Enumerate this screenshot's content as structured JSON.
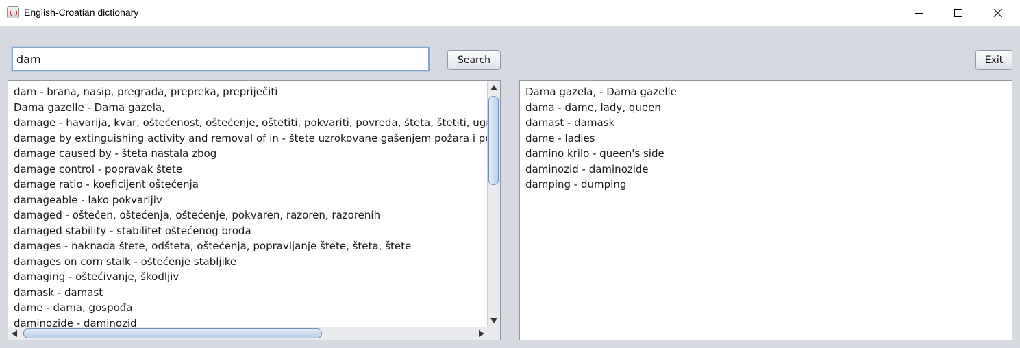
{
  "window": {
    "title": "English-Croatian dictionary"
  },
  "search": {
    "value": "dam",
    "button_label": "Search"
  },
  "exit_label": "Exit",
  "results_left": [
    "dam - brana, nasip, pregrada, prepreka, prepriječiti",
    "Dama gazelle - Dama gazela,",
    "damage - havarija, kvar, oštećenost, oštećenje, oštetiti, pokvariti, povreda, šteta, štetiti, ugruvat",
    "damage by extinguishing activity and removal of in - štete uzrokovane gašenjem požara i pomic",
    "damage caused by - šteta nastala zbog",
    "damage control - popravak štete",
    "damage ratio - koeficijent oštećenja",
    "damageable - lako pokvarljiv",
    "damaged - oštećen, oštećenja, oštećenje, pokvaren, razoren, razorenih",
    "damaged stability - stabilitet oštećenog broda",
    "damages - naknada štete, odšteta, oštećenja, popravljanje štete, šteta, štete",
    "damages on corn stalk - oštećenje stabljike",
    "damaging - oštećivanje, škodljiv",
    "damask - damast",
    "dame - dama, gospođa",
    "daminozide - daminozid"
  ],
  "results_right": [
    "Dama gazela, - Dama gazelle",
    "dama - dame, lady, queen",
    "damast - damask",
    "dame - ladies",
    "damino krilo - queen's side",
    "daminozid - daminozide",
    "damping - dumping"
  ]
}
